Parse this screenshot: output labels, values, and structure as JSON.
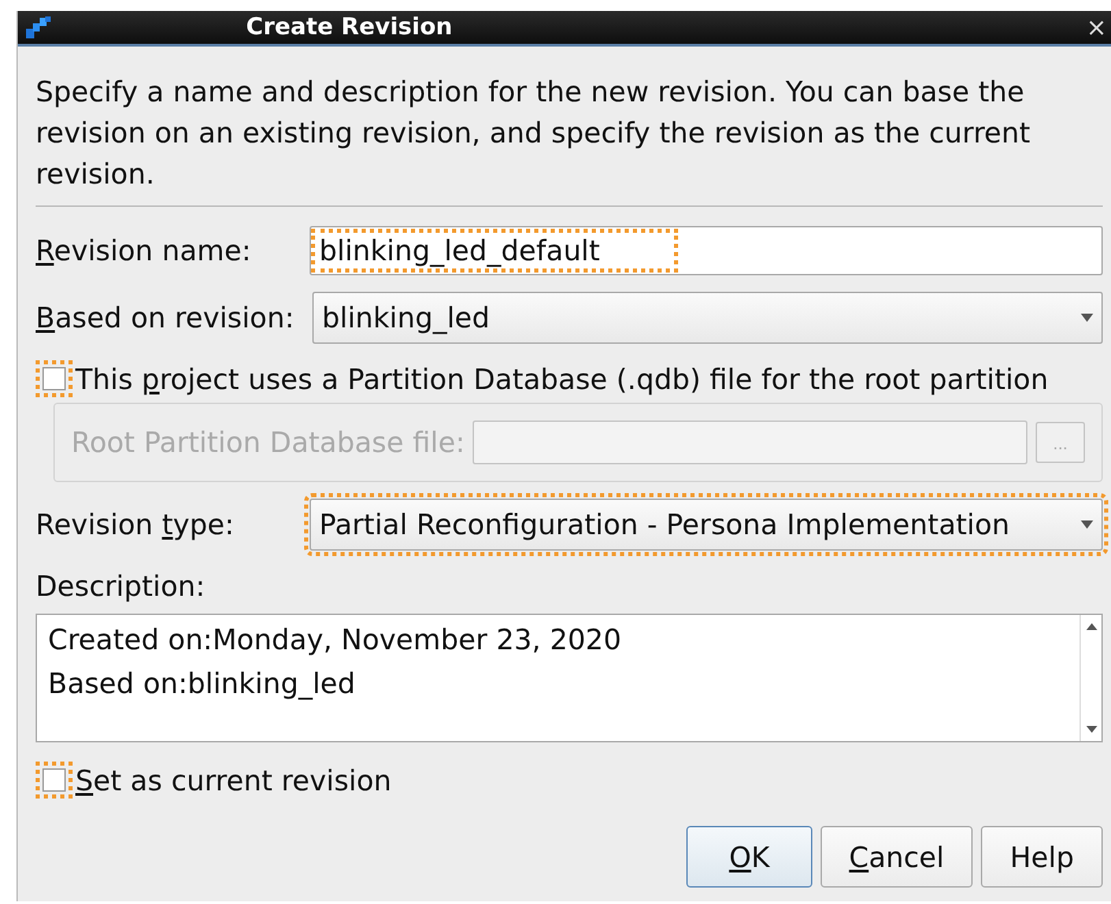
{
  "window": {
    "title": "Create Revision",
    "close": "×"
  },
  "intro": "Specify a name and description for the new revision. You can base the revision on an existing revision, and specify the revision as the current revision.",
  "revision_name": {
    "label": {
      "key": "R",
      "post": "evision name:"
    },
    "value": "blinking_led_default",
    "highlighted": true
  },
  "based_on": {
    "label": {
      "key": "B",
      "post": "ased on revision:"
    },
    "value": "blinking_led",
    "highlighted": false
  },
  "uses_partition_db": {
    "label": {
      "pre": "This ",
      "key": "p",
      "post": "roject uses a Partition Database (.qdb) file for the root partition"
    },
    "checked": false,
    "highlighted": true
  },
  "root_partition_file": {
    "label": "Root Partition Database file:",
    "disabled": true,
    "browse": "..."
  },
  "revision_type": {
    "label": {
      "pre": "Revision ",
      "key": "t",
      "post": "ype:"
    },
    "value": "Partial Reconfiguration - Persona Implementation",
    "highlighted": true
  },
  "description": {
    "label": "Description:",
    "lines": [
      "Created on:Monday, November 23, 2020",
      "Based on:blinking_led"
    ]
  },
  "set_current": {
    "label": {
      "key": "S",
      "post": "et as current revision"
    },
    "checked": false,
    "highlighted": true
  },
  "buttons": [
    {
      "label": {
        "key": "O",
        "post": "K"
      },
      "default": true
    },
    {
      "label": {
        "key": "C",
        "post": "ancel"
      },
      "default": false
    },
    {
      "label": {
        "post": "Help"
      },
      "default": false
    }
  ]
}
